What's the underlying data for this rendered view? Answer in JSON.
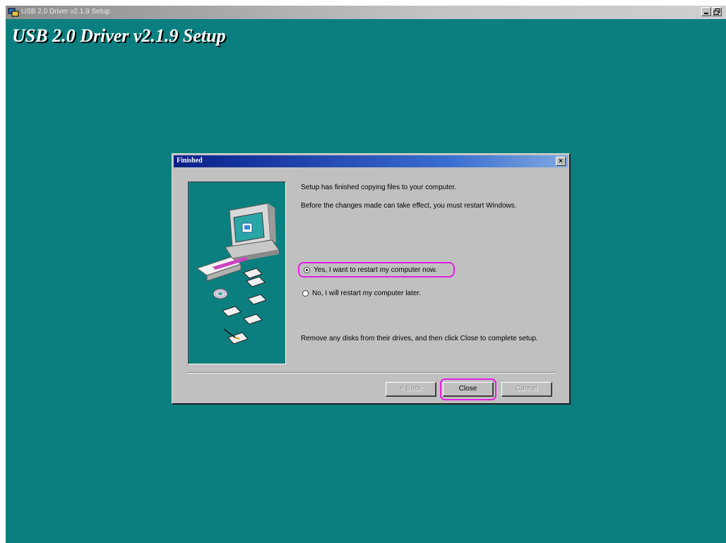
{
  "app": {
    "window_title": "USB 2.0 Driver v2.1.9 Setup",
    "heading": "USB 2.0 Driver v2.1.9 Setup"
  },
  "dialog": {
    "title": "Finished",
    "close_glyph": "×",
    "message_copy": "Setup has finished copying files to your computer.",
    "message_restart": "Before the changes made can take effect, you must restart Windows.",
    "options": [
      {
        "label": "Yes, I want to restart my computer now.",
        "selected": true
      },
      {
        "label": "No, I will restart my computer later.",
        "selected": false
      }
    ],
    "message_remove": "Remove any disks from their drives, and then click Close to complete setup.",
    "buttons": {
      "back": "< Back",
      "close": "Close",
      "cancel": "Cancel"
    }
  },
  "colors": {
    "desktop": "#0b7f7f",
    "highlight": "#e020e0",
    "dialog_face": "#c0c0c0",
    "title_start": "#0a1f8a"
  },
  "icons": [
    "setup-app-icon",
    "computer-icon",
    "cd-disc-icon",
    "floppy-disk-icon",
    "close-icon"
  ]
}
